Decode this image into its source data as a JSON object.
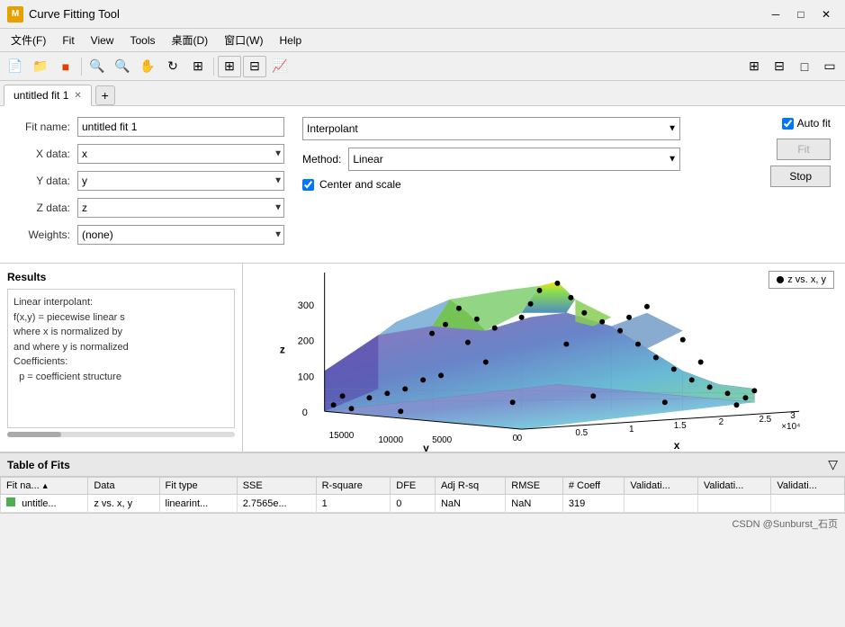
{
  "titleBar": {
    "title": "Curve Fitting Tool",
    "iconLabel": "M",
    "minBtn": "─",
    "maxBtn": "□",
    "closeBtn": "✕"
  },
  "menuBar": {
    "items": [
      "文件(F)",
      "Fit",
      "View",
      "Tools",
      "桌面(D)",
      "窗口(W)",
      "Help"
    ]
  },
  "tabs": {
    "items": [
      {
        "label": "untitled fit 1",
        "active": true
      }
    ],
    "addLabel": "+"
  },
  "fitForm": {
    "fitNameLabel": "Fit name:",
    "fitNameValue": "untitled fit 1",
    "xDataLabel": "X data:",
    "xDataValue": "x",
    "yDataLabel": "Y data:",
    "yDataValue": "y",
    "zDataLabel": "Z data:",
    "zDataValue": "z",
    "weightsLabel": "Weights:",
    "weightsValue": "(none)"
  },
  "fitOptions": {
    "fitTypeValue": "Interpolant",
    "methodLabel": "Method:",
    "methodValue": "Linear",
    "centerScaleLabel": "Center and scale",
    "centerScaleChecked": true
  },
  "buttons": {
    "autoFitLabel": "Auto fit",
    "autoFitChecked": true,
    "fitLabel": "Fit",
    "stopLabel": "Stop"
  },
  "results": {
    "title": "Results",
    "content": "Linear interpolant:\nf(x,y) = piecewise linear s\nwhere x is normalized by\nand where y is normalized\nCoefficients:\n  p = coefficient structure"
  },
  "chart": {
    "legendText": "z vs. x, y",
    "xAxisLabel": "x",
    "yAxisLabel": "y",
    "zAxisLabel": "z",
    "xAxisValues": [
      "0",
      "0.5",
      "1",
      "1.5",
      "2",
      "2.5",
      "3"
    ],
    "yAxisValues": [
      "0",
      "5000",
      "10000",
      "15000"
    ],
    "zAxisValues": [
      "0",
      "100",
      "200",
      "300"
    ],
    "xScaleNote": "×10⁴"
  },
  "tableOfFits": {
    "title": "Table of Fits",
    "columns": [
      "Fit na...",
      "Data",
      "Fit type",
      "SSE",
      "R-square",
      "DFE",
      "Adj R-sq",
      "RMSE",
      "# Coeff",
      "Validati...",
      "Validati...",
      "Validati..."
    ],
    "rows": [
      {
        "fitName": "untitle...",
        "data": "z vs. x, y",
        "fitType": "linearint...",
        "sse": "2.7565e...",
        "rsquare": "1",
        "dfe": "0",
        "adjRsq": "NaN",
        "rmse": "NaN",
        "nCoeff": "319",
        "val1": "",
        "val2": "",
        "val3": ""
      }
    ]
  },
  "statusBar": {
    "text": "CSDN @Sunburst_石页"
  }
}
